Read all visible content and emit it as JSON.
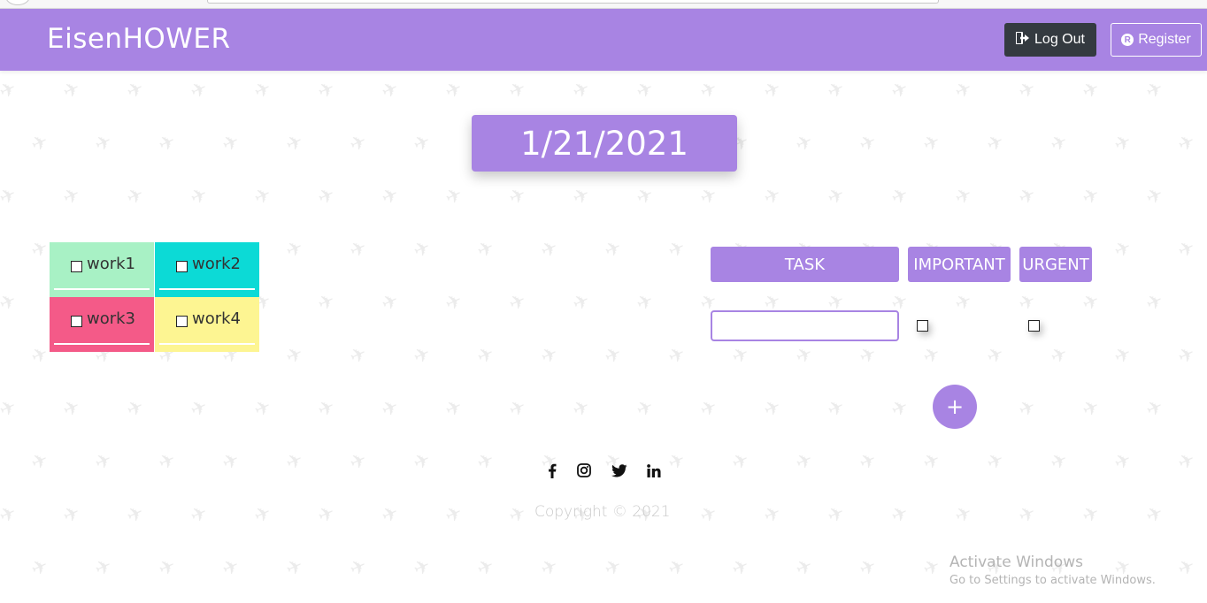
{
  "app": {
    "brand": "EisenHOWER"
  },
  "nav": {
    "logout_label": "Log Out",
    "register_label": "Register",
    "logout_icon": "sign-out-icon",
    "register_icon": "registered-icon"
  },
  "date": "1/21/2021",
  "quadrants": [
    {
      "label": "work1",
      "color": "#a8f1c5",
      "checked": false
    },
    {
      "label": "work2",
      "color": "#0cdad6",
      "checked": false
    },
    {
      "label": "work3",
      "color": "#f45a88",
      "checked": false
    },
    {
      "label": "work4",
      "color": "#fdf592",
      "checked": false
    }
  ],
  "form": {
    "task_header": "TASK",
    "important_header": "IMPORTANT",
    "urgent_header": "URGENT",
    "task_value": "",
    "important_checked": false,
    "urgent_checked": false,
    "add_label": "+"
  },
  "social": [
    "facebook-icon",
    "instagram-icon",
    "twitter-icon",
    "linkedin-icon"
  ],
  "footer": {
    "copyright": "Copyright © 2021"
  },
  "watermark": {
    "title": "Activate Windows",
    "subtitle": "Go to Settings to activate Windows."
  },
  "colors": {
    "accent": "#a884e3",
    "dark_button": "#343a40"
  }
}
